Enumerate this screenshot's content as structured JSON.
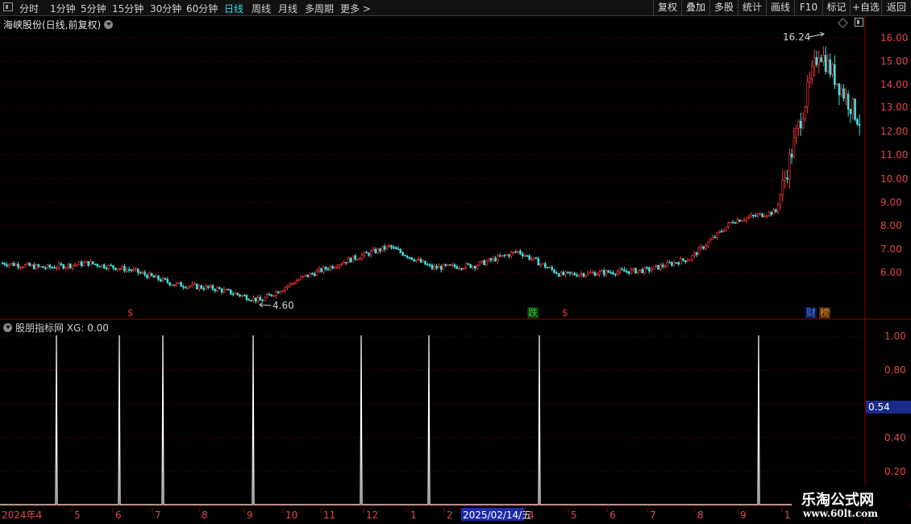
{
  "toolbar": {
    "periods": [
      "分时",
      "1分钟",
      "5分钟",
      "15分钟",
      "30分钟",
      "60分钟",
      "日线",
      "周线",
      "月线",
      "多周期",
      "更多 >"
    ],
    "active_period": "日线",
    "right_buttons": [
      "复权",
      "叠加",
      "多股",
      "统计",
      "画线",
      "F10",
      "标记",
      "+自选",
      "返回"
    ]
  },
  "main_chart": {
    "title": "海峡股份(日线,前复权)",
    "y_ticks": [
      "16.00",
      "15.00",
      "14.00",
      "13.00",
      "12.00",
      "11.00",
      "10.00",
      "9.00",
      "8.00",
      "7.00",
      "6.00"
    ],
    "high_label": "16.24",
    "low_label": "4.60",
    "markers": [
      {
        "text": "$",
        "color": "#e03030"
      },
      {
        "text": "跌",
        "color": "#36c436"
      },
      {
        "text": "$",
        "color": "#e03030"
      },
      {
        "text": "财",
        "color": "#4a7cff"
      },
      {
        "text": "榜",
        "color": "#e08a30"
      }
    ]
  },
  "sub_chart": {
    "title": "股朋指标网 XG: 0.00",
    "y_ticks": [
      "1.00",
      "0.80",
      "0.60",
      "0.40",
      "0.20"
    ],
    "current_value": "0.54",
    "xg_spikes": [
      "2024-04",
      "2024-06",
      "2024-07",
      "2024-09",
      "2024-12",
      "2025-01",
      "2025-04",
      "2025-09"
    ]
  },
  "x_axis": {
    "labels": [
      "2024年4",
      "5",
      "6",
      "7",
      "8",
      "9",
      "10",
      "11",
      "12",
      "1",
      "2",
      "2025/02/14/五",
      "4",
      "5",
      "6",
      "7",
      "8",
      "9",
      "1"
    ]
  },
  "watermark": {
    "line1": "乐淘公式网",
    "line2": "www.60lt.com"
  },
  "colors": {
    "up": "#ff3a3a",
    "down": "#40e0e0",
    "grid": "#7a1010",
    "axis": "#8b0000",
    "text": "#c8c8c8"
  },
  "chart_data": {
    "type": "candlestick",
    "title": "海峡股份(日线,前复权)",
    "ylim": [
      4.6,
      16.24
    ],
    "close_series": [
      {
        "x": "2024-03",
        "y": 6.4
      },
      {
        "x": "2024-04",
        "y": 6.2
      },
      {
        "x": "2024-05",
        "y": 6.4
      },
      {
        "x": "2024-06",
        "y": 6.1
      },
      {
        "x": "2024-07",
        "y": 5.5
      },
      {
        "x": "2024-08",
        "y": 5.3
      },
      {
        "x": "2024-09",
        "y": 4.8
      },
      {
        "x": "2024-10",
        "y": 5.8
      },
      {
        "x": "2024-11",
        "y": 6.5
      },
      {
        "x": "2024-12",
        "y": 7.1
      },
      {
        "x": "2025-01",
        "y": 6.2
      },
      {
        "x": "2025-02",
        "y": 6.3
      },
      {
        "x": "2025-03",
        "y": 6.9
      },
      {
        "x": "2025-04",
        "y": 5.9
      },
      {
        "x": "2025-05",
        "y": 6.0
      },
      {
        "x": "2025-06",
        "y": 6.1
      },
      {
        "x": "2025-07",
        "y": 6.6
      },
      {
        "x": "2025-08",
        "y": 8.2
      },
      {
        "x": "2025-09",
        "y": 8.6
      },
      {
        "x": "2025-10",
        "y": 15.5
      },
      {
        "x": "2025-11",
        "y": 12.3
      }
    ]
  }
}
